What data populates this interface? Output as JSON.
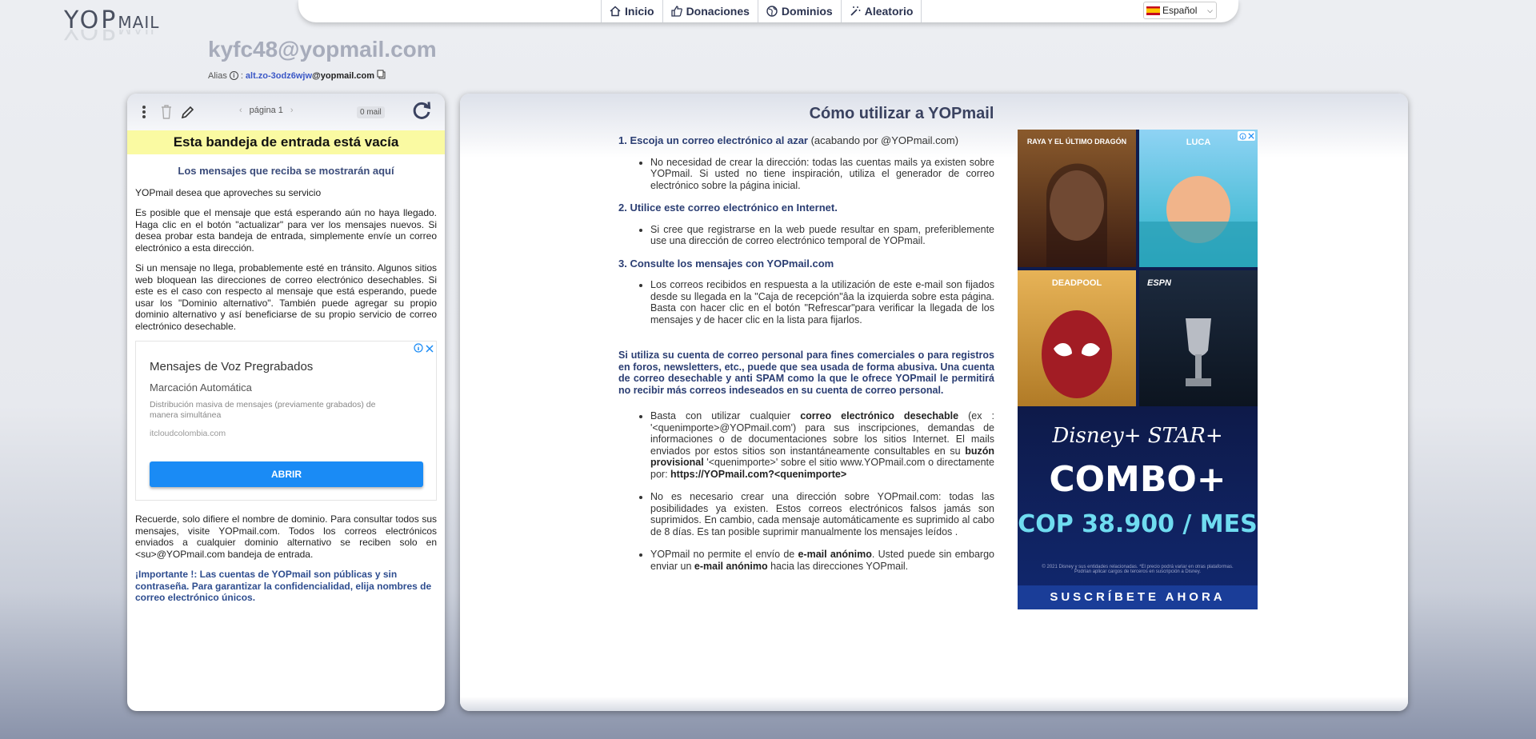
{
  "logo": {
    "main": "YOP",
    "small": "MAIL"
  },
  "nav": {
    "inicio": "Inicio",
    "donaciones": "Donaciones",
    "dominios": "Dominios",
    "aleatorio": "Aleatorio",
    "language": "Español"
  },
  "mailbox": {
    "email": "kyfc48@yopmail.com",
    "alias_label": "Alias",
    "alias_sep": ":",
    "alias_value": "alt.zo-3odz6wjw",
    "alias_domain": "@yopmail.com"
  },
  "inbox": {
    "page_label": "página 1",
    "mail_count": "0 mail",
    "empty_banner": "Esta bandeja de entrada está vacía",
    "subheading": "Los mensajes que reciba se mostrarán aquí",
    "p1": "YOPmail desea que aproveches su servicio",
    "p2": "Es posible que el mensaje que está esperando aún no haya llegado. Haga clic en el botón \"actualizar\" para ver los mensajes nuevos. Si desea probar esta bandeja de entrada, simplemente envíe un correo electrónico a esta dirección.",
    "p3": "Si un mensaje no llega, probablemente esté en tránsito. Algunos sitios web bloquean las direcciones de correo electrónico desechables. Si este es el caso con respecto al mensaje que está esperando, puede usar los \"Dominio alternativo\". También puede agregar su propio dominio alternativo y así beneficiarse de su propio servicio de correo electrónico desechable.",
    "p4": "Recuerde, solo difiere el nombre de dominio. Para consultar todos sus mensajes, visite YOPmail.com. Todos los correos electrónicos enviados a cualquier dominio alternativo se reciben solo en <su>@YOPmail.com bandeja de entrada.",
    "important": "¡Importante !: Las cuentas de YOPmail son públicas y sin contraseña. Para garantizar la confidencialidad, elija nombres de correo electrónico únicos."
  },
  "left_ad": {
    "title": "Mensajes de Voz Pregrabados",
    "subtitle": "Marcación Automática",
    "description": "Distribución masiva de mensajes (previamente grabados) de manera simultánea",
    "domain": "itcloudcolombia.com",
    "button": "ABRIR"
  },
  "howto": {
    "title": "Cómo utilizar a YOPmail",
    "s1_title": "1. Escoja un correo electrónico al azar",
    "s1_suffix": " (acabando por @YOPmail.com)",
    "s1_li": "No necesidad de crear la dirección: todas las cuentas mails ya existen sobre YOPmail. Si usted no tiene inspiración, utiliza el generador de correo electrónico sobre la página inicial.",
    "s2_title": "2. Utilice este correo electrónico en Internet.",
    "s2_li": "Si cree que registrarse en la web puede resultar en spam, preferiblemente use una dirección de correo electrónico temporal de YOPmail.",
    "s3_title": "3. Consulte los mensajes con YOPmail.com",
    "s3_li": "Los correos recibidos en respuesta a la utilización de este e-mail son fijados desde su llegada en la \"Caja de recepción\"âa la izquierda sobre esta página. Basta con hacer clic en el botón \"Refrescar\"para verificar la llegada de los mensajes y de hacer clic en la lista para fijarlos.",
    "warning": "Si utiliza su cuenta de correo personal para fines comerciales o para registros en foros, newsletters, etc., puede que sea usada de forma abusiva. Una cuenta de correo desechable y anti SPAM como la que le ofrece YOPmail le permitirá no recibir más correos indeseados en su cuenta de correo personal.",
    "b1_a": "Basta con utilizar cualquier ",
    "b1_b": "correo electrónico desechable",
    "b1_c": " (ex : '<quenimporte>@YOPmail.com') para sus inscripciones, demandas de informaciones o de documentaciones sobre los sitios Internet. El mails enviados por estos sitios son instantáneamente consultables en su ",
    "b1_d": "buzón provisional",
    "b1_e": " '<quenimporte>' sobre el sitio www.YOPmail.com o directamente por: ",
    "b1_f": "https://YOPmail.com?<quenimporte>",
    "b2": "No es necesario crear una dirección sobre YOPmail.com: todas las posibilidades ya existen. Estos correos electrónicos falsos jamás son suprimidos. En cambio, cada mensaje automáticamente es suprimido al cabo de 8 días. Es tan posible suprimir manualmente los mensajes leídos .",
    "b3_a": "YOPmail no permite el envío de ",
    "b3_b": "e-mail anónimo",
    "b3_c": ". Usted puede sin embargo enviar un ",
    "b3_d": "e-mail anónimo",
    "b3_e": " hacia las direcciones YOPmail."
  },
  "right_ad": {
    "tile1": "RAYA Y EL ÚLTIMO DRAGÓN",
    "tile2": "LUCA",
    "tile3": "DEADPOOL",
    "tile4": "ESPN",
    "brand": "Disney+ STAR+",
    "combo": "COMBO+",
    "price": "COP 38.900 / MES",
    "fine_print": "© 2021 Disney y sus entidades relacionadas. *El precio podrá variar en otras plataformas. Podrían aplicar cargos de terceros en suscripción a Disney.",
    "cta": "SUSCRÍBETE AHORA"
  },
  "colors": {
    "accent": "#2b3e73",
    "ad_button": "#1a8bf5",
    "banner": "#fafaa2"
  }
}
